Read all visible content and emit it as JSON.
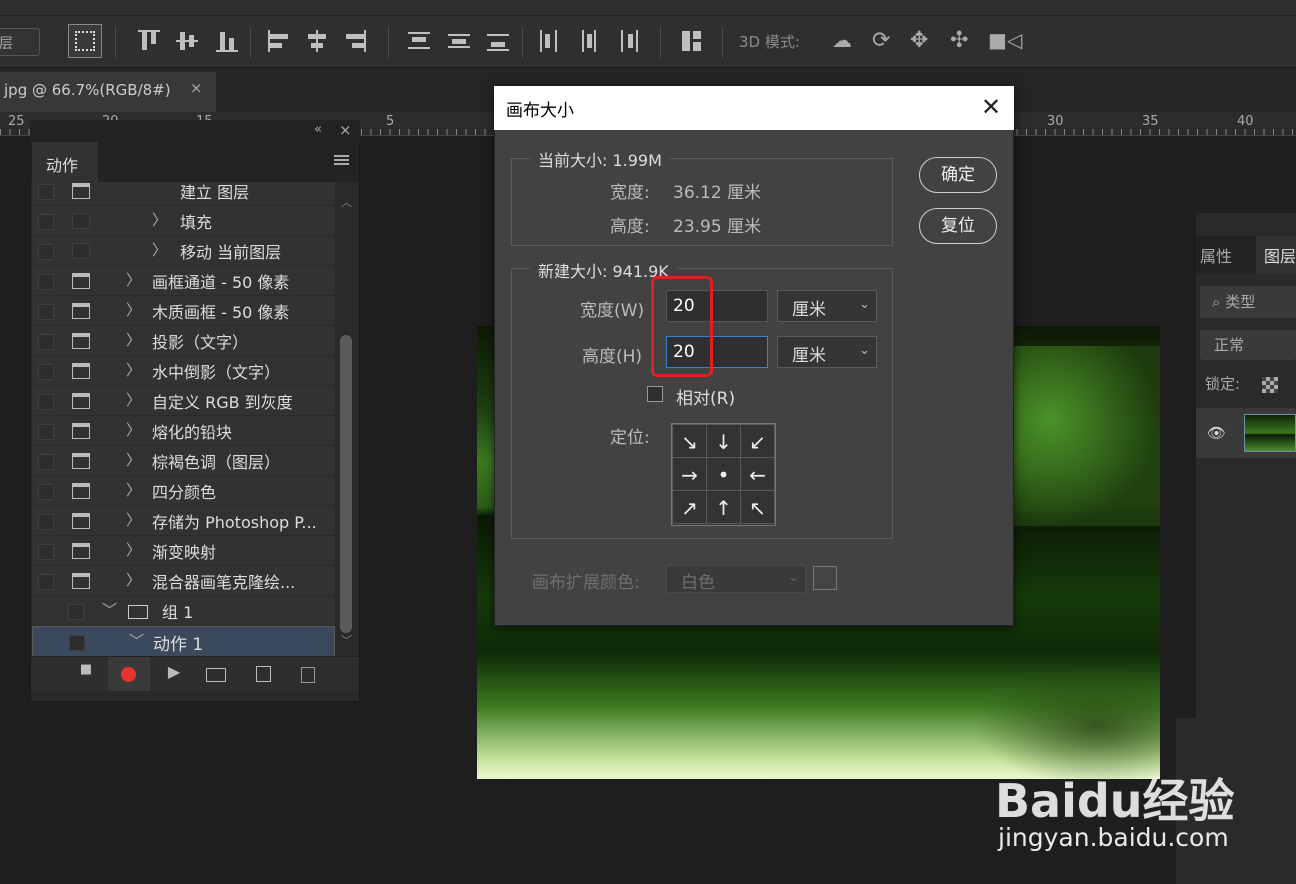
{
  "options_bar": {
    "layer_select": "层",
    "mode_3d_label": "3D 模式:"
  },
  "document_tab": {
    "title": "jpg @ 66.7%(RGB/8#)",
    "close": "×"
  },
  "ruler": {
    "labels": [
      "25",
      "20",
      "15",
      "5",
      "30",
      "35",
      "40"
    ]
  },
  "actions_panel": {
    "tab": "动作",
    "collapse": "«",
    "close": "×",
    "items": [
      {
        "label": "建立 图层",
        "level": 2
      },
      {
        "label": "填充",
        "level": 2
      },
      {
        "label": "移动 当前图层",
        "level": 2
      },
      {
        "label": "画框通道 - 50 像素",
        "level": 1
      },
      {
        "label": "木质画框 - 50 像素",
        "level": 1
      },
      {
        "label": "投影（文字）",
        "level": 1
      },
      {
        "label": "水中倒影（文字）",
        "level": 1
      },
      {
        "label": "自定义 RGB 到灰度",
        "level": 1
      },
      {
        "label": "熔化的铅块",
        "level": 1
      },
      {
        "label": "棕褐色调（图层）",
        "level": 1
      },
      {
        "label": "四分颜色",
        "level": 1
      },
      {
        "label": "存储为 Photoshop P...",
        "level": 1
      },
      {
        "label": "渐变映射",
        "level": 1
      },
      {
        "label": "混合器画笔克隆绘...",
        "level": 1
      },
      {
        "label": "组 1",
        "level": 0
      },
      {
        "label": "动作 1",
        "level": 1
      }
    ],
    "footer": {
      "stop": "■",
      "play": "▶"
    }
  },
  "right_panel": {
    "tab_properties": "属性",
    "tab_layers": "图层",
    "search_placeholder": "类型",
    "blend_mode": "正常",
    "lock_label": "锁定:"
  },
  "dialog": {
    "title": "画布大小",
    "current_size_label": "当前大小: 1.99M",
    "current_width_label": "宽度:",
    "current_width_value": "36.12 厘米",
    "current_height_label": "高度:",
    "current_height_value": "23.95 厘米",
    "new_size_label": "新建大小: 941.9K",
    "width_label": "宽度(W)",
    "width_value": "20",
    "width_unit": "厘米",
    "height_label": "高度(H)",
    "height_value": "20",
    "height_unit": "厘米",
    "relative_label": "相对(R)",
    "relative_checked": false,
    "anchor_label": "定位:",
    "ok_button": "确定",
    "reset_button": "复位",
    "extension_color_label": "画布扩展颜色:",
    "extension_color_value": "白色",
    "anchor_arrows": [
      "↘",
      "↓",
      "↙",
      "→",
      "•",
      "←",
      "↗",
      "↑",
      "↖"
    ]
  },
  "watermark": {
    "logo": "Baidu经验",
    "url": "jingyan.baidu.com"
  },
  "accent_colors": {
    "highlight_box": "#e0201e",
    "record_button": "#e6352f",
    "focus_border": "#3d7fd0"
  }
}
